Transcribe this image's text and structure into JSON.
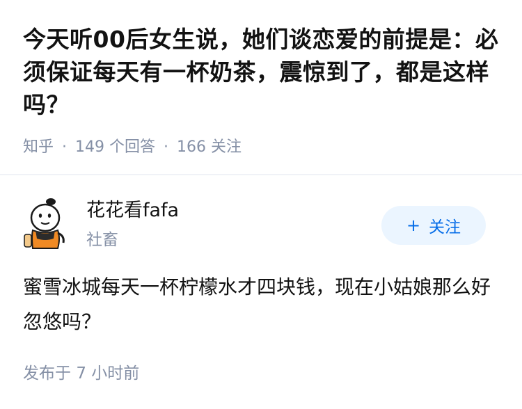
{
  "question": {
    "title": "今天听00后女生说，她们谈恋爱的前提是：必须保证每天有一杯奶茶，震惊到了，都是这样吗？",
    "source": "知乎",
    "answer_count": "149",
    "answer_suffix": "个回答",
    "follower_count": "166",
    "follower_suffix": "关注",
    "separator": "·"
  },
  "answer": {
    "author_name": "花花看fafa",
    "author_bio": "社畜",
    "follow_icon": "plus-icon",
    "follow_label": "关注",
    "content": "蜜雪冰城每天一杯柠檬水才四块钱，现在小姑娘那么好忽悠吗？",
    "published_prefix": "发布于",
    "published_time": "7 小时前"
  },
  "colors": {
    "title": "#121212",
    "meta": "#8590a6",
    "accent": "#056de8",
    "follow_bg": "#ebf5ff",
    "divider": "#f0f2f7"
  }
}
